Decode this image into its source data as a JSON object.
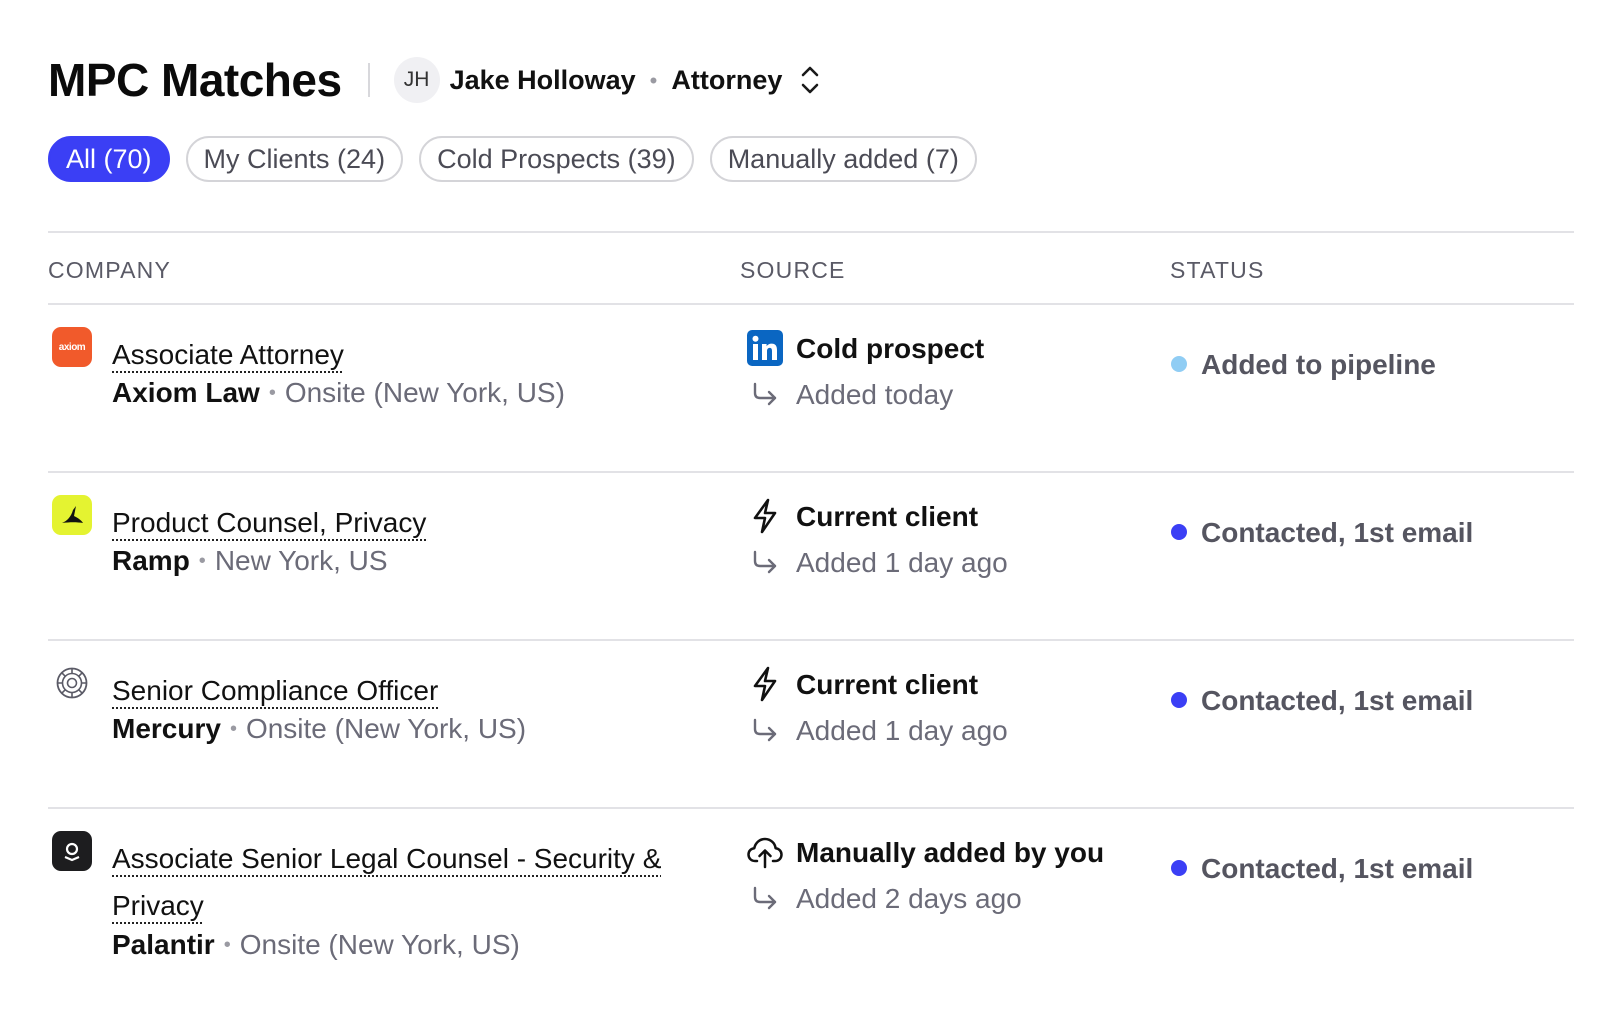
{
  "header": {
    "title": "MPC Matches",
    "user": {
      "initials": "JH",
      "name": "Jake Holloway",
      "role": "Attorney"
    }
  },
  "tabs": [
    {
      "label": "All (70)",
      "active": true
    },
    {
      "label": "My Clients (24)",
      "active": false
    },
    {
      "label": "Cold Prospects (39)",
      "active": false
    },
    {
      "label": "Manually added (7)",
      "active": false
    }
  ],
  "table": {
    "columns": [
      "COMPANY",
      "SOURCE",
      "STATUS"
    ],
    "rows": [
      {
        "logo": "axiom-logo",
        "logo_text": "axiom",
        "title": "Associate Attorney",
        "company": "Axiom Law",
        "location": "Onsite (New York, US)",
        "source_icon": "linkedin-icon",
        "source": "Cold prospect",
        "added": "Added today",
        "status": "Added to pipeline",
        "status_color": "#90cdf4"
      },
      {
        "logo": "ramp-logo",
        "title": "Product Counsel, Privacy",
        "company": "Ramp",
        "location": "New York, US",
        "source_icon": "lightning-icon",
        "source": "Current client",
        "added": "Added 1 day ago",
        "status": "Contacted, 1st email",
        "status_color": "#3b3ff5"
      },
      {
        "logo": "mercury-logo",
        "title": "Senior Compliance Officer",
        "company": "Mercury",
        "location": "Onsite (New York, US)",
        "source_icon": "lightning-icon",
        "source": "Current client",
        "added": "Added 1 day ago",
        "status": "Contacted, 1st email",
        "status_color": "#3b3ff5"
      },
      {
        "logo": "palantir-logo",
        "title": "Associate Senior Legal Counsel - Security & Privacy",
        "company": "Palantir",
        "location": "Onsite (New York, US)",
        "source_icon": "cloud-upload-icon",
        "source": "Manually added by you",
        "added": "Added 2 days ago",
        "status": "Contacted, 1st email",
        "status_color": "#3b3ff5"
      }
    ]
  }
}
